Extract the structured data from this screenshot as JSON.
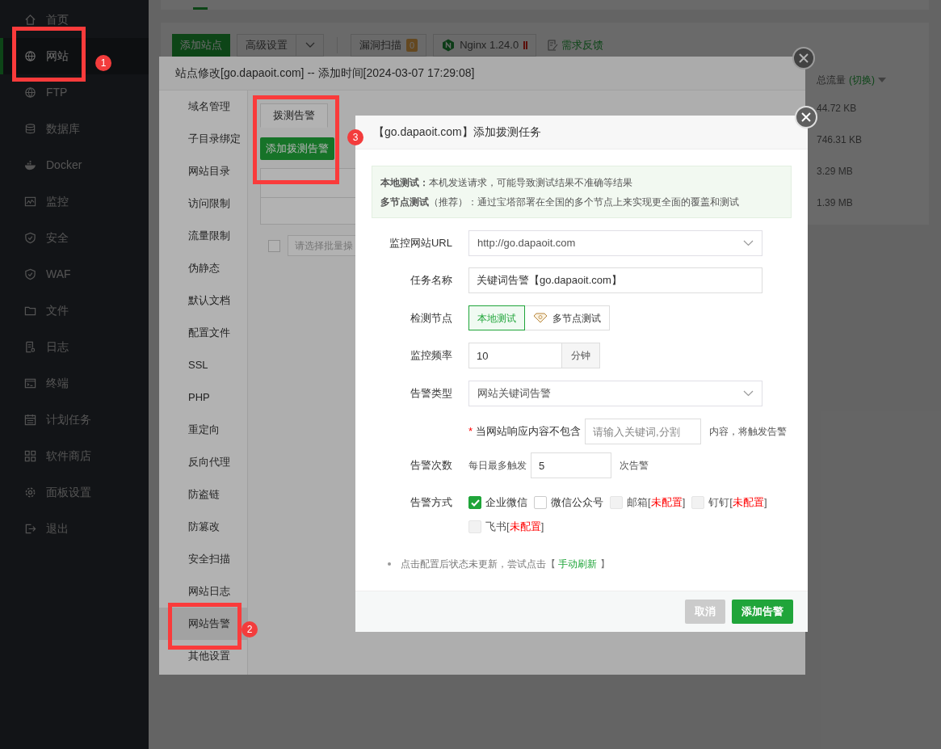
{
  "sidebar": {
    "items": [
      {
        "label": "首页",
        "selected": false
      },
      {
        "label": "网站",
        "selected": true
      },
      {
        "label": "FTP",
        "selected": false
      },
      {
        "label": "数据库",
        "selected": false
      },
      {
        "label": "Docker",
        "selected": false
      },
      {
        "label": "监控",
        "selected": false
      },
      {
        "label": "安全",
        "selected": false
      },
      {
        "label": "WAF",
        "selected": false
      },
      {
        "label": "文件",
        "selected": false
      },
      {
        "label": "日志",
        "selected": false
      },
      {
        "label": "终端",
        "selected": false
      },
      {
        "label": "计划任务",
        "selected": false
      },
      {
        "label": "软件商店",
        "selected": false
      },
      {
        "label": "面板设置",
        "selected": false
      },
      {
        "label": "退出",
        "selected": false
      }
    ]
  },
  "toolbar": {
    "add_site": "添加站点",
    "advanced": "高级设置",
    "scan": "漏洞扫描",
    "scan_count": "0",
    "nginx": "Nginx 1.24.0",
    "feedback": "需求反馈"
  },
  "traffic_table": {
    "column": "总流量",
    "toggle": "(切换)",
    "rows": [
      "44.72 KB",
      "746.31 KB",
      "3.29 MB",
      "1.39 MB"
    ]
  },
  "site_dialog": {
    "title": "站点修改[go.dapaoit.com] -- 添加时间[2024-03-07 17:29:08]",
    "nav": [
      {
        "label": "域名管理",
        "selected": false
      },
      {
        "label": "子目录绑定",
        "selected": false
      },
      {
        "label": "网站目录",
        "selected": false
      },
      {
        "label": "访问限制",
        "selected": false
      },
      {
        "label": "流量限制",
        "selected": false
      },
      {
        "label": "伪静态",
        "selected": false
      },
      {
        "label": "默认文档",
        "selected": false
      },
      {
        "label": "配置文件",
        "selected": false
      },
      {
        "label": "SSL",
        "selected": false
      },
      {
        "label": "PHP",
        "selected": false
      },
      {
        "label": "重定向",
        "selected": false
      },
      {
        "label": "反向代理",
        "selected": false
      },
      {
        "label": "防盗链",
        "selected": false
      },
      {
        "label": "防篡改",
        "selected": false
      },
      {
        "label": "安全扫描",
        "selected": false
      },
      {
        "label": "网站日志",
        "selected": false
      },
      {
        "label": "网站告警",
        "selected": true
      },
      {
        "label": "其他设置",
        "selected": false
      }
    ],
    "tabs": [
      {
        "label": "拨测告警",
        "selected": true
      }
    ],
    "add_button": "添加拨测告警",
    "batch_checked": false,
    "batch_placeholder": "请选择批量操"
  },
  "task_dialog": {
    "title": "【go.dapaoit.com】添加拨测任务",
    "notes": [
      "**本地测试：**本机发送请求，可能导致测试结果不准确等结果",
      "**多节点测试**（推荐）：通过宝塔部署在全国的多个节点上来实现更全面的覆盖和测试"
    ],
    "url": {
      "label": "监控网站URL",
      "value": "http://go.dapaoit.com"
    },
    "name": {
      "label": "任务名称",
      "value": "关键词告警【go.dapaoit.com】"
    },
    "node": {
      "label": "检测节点",
      "options": [
        {
          "label": "本地测试",
          "selected": true
        },
        {
          "label": "多节点测试",
          "selected": false
        }
      ]
    },
    "frequency": {
      "label": "监控频率",
      "value": "10",
      "unit": "分钟"
    },
    "type": {
      "label": "告警类型",
      "value": "网站关键词告警"
    },
    "keyword": {
      "required": "*",
      "prefix": "当网站响应内容不包含",
      "placeholder": "请输入关键词,分割",
      "suffix": "内容，将触发告警"
    },
    "count": {
      "label": "告警次数",
      "prefix": "每日最多触发",
      "value": "5",
      "suffix": "次告警"
    },
    "methods": {
      "label": "告警方式",
      "items": [
        {
          "label": "企业微信",
          "checked": true,
          "disabled": false
        },
        {
          "label": "微信公众号",
          "checked": false,
          "disabled": false
        },
        {
          "label": "邮箱[",
          "status": "未配置",
          "tail": "]",
          "checked": false,
          "disabled": true
        },
        {
          "label": "钉钉[",
          "status": "未配置",
          "tail": "]",
          "checked": false,
          "disabled": true
        },
        {
          "label": "飞书[",
          "status": "未配置",
          "tail": "]",
          "checked": false,
          "disabled": true
        }
      ]
    },
    "hint": "点击配置后状态未更新，尝试点击【",
    "hint_link": "手动刷新",
    "hint_end": "】",
    "cancel": "取消",
    "submit": "添加告警"
  },
  "annotations": [
    "1",
    "2",
    "3"
  ]
}
